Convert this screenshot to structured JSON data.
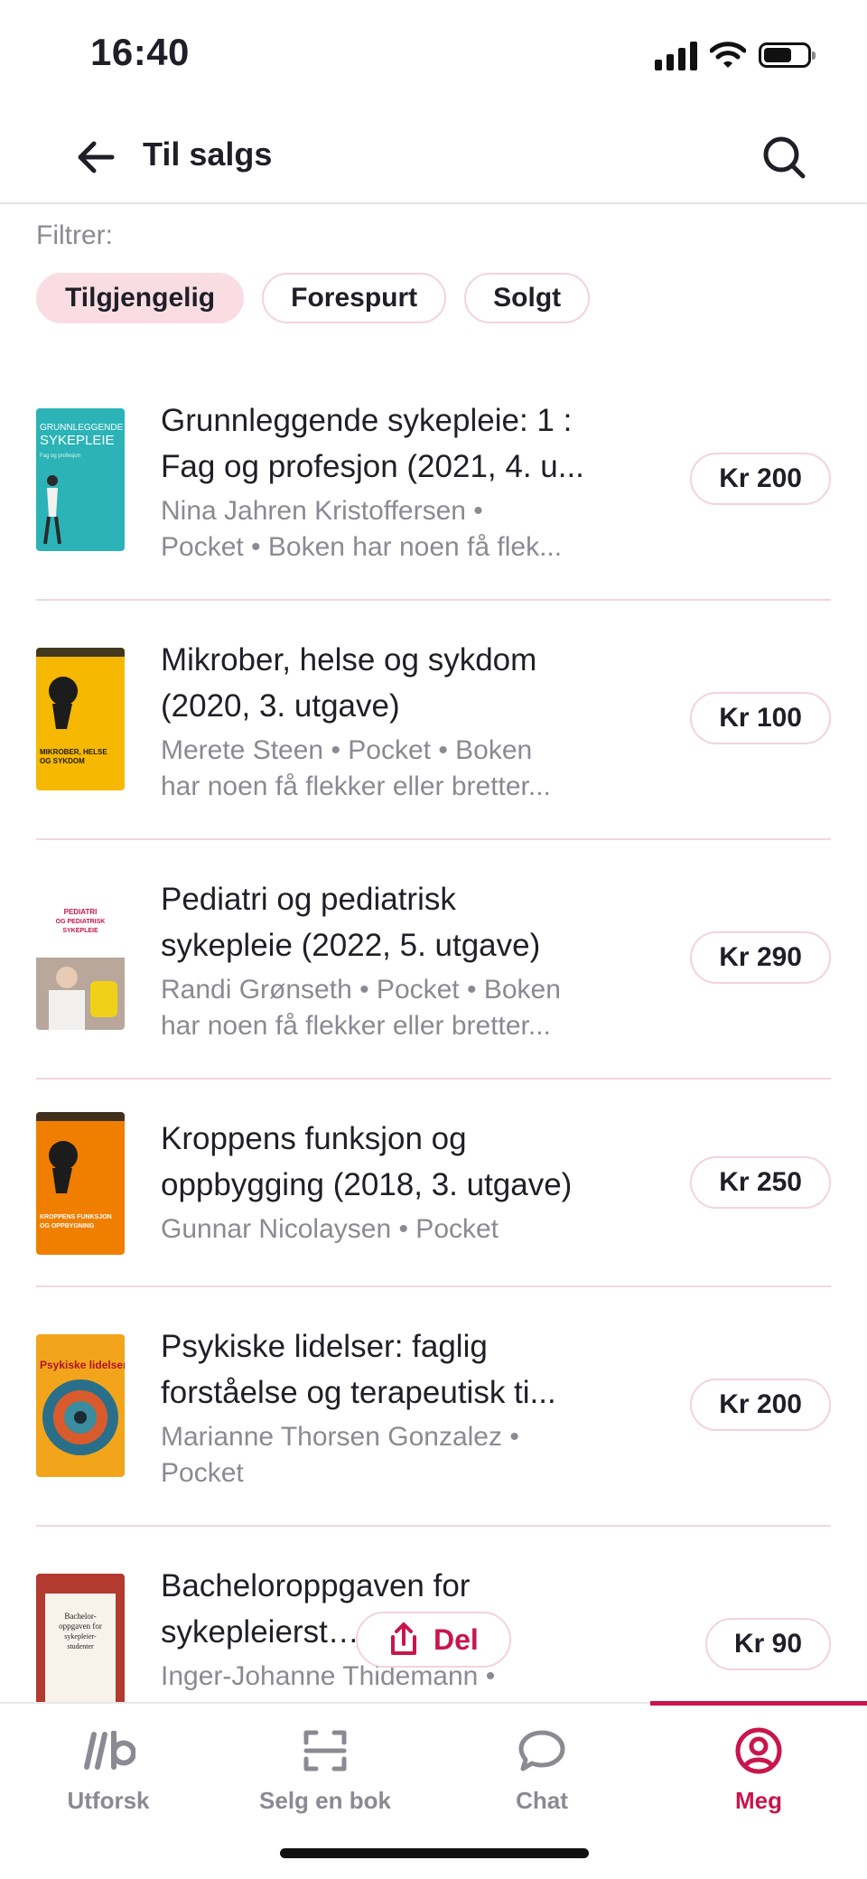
{
  "status": {
    "time": "16:40"
  },
  "header": {
    "title": "Til salgs"
  },
  "filters": {
    "label": "Filtrer:",
    "chips": [
      "Tilgjengelig",
      "Forespurt",
      "Solgt"
    ],
    "active": "Tilgjengelig"
  },
  "listings": [
    {
      "title_line1": "Grunnleggende sykepleie: 1 :",
      "title_line2": "Fag og profesjon (2021, 4. u...",
      "sub_line1": "Nina Jahren Kristoffersen •",
      "sub_line2": "Pocket • Boken har noen få flek...",
      "price": "Kr 200",
      "cover_text": "GRUNNLEGGENDE SYKEPLEIE",
      "cover_color": "#2bb3b7"
    },
    {
      "title_line1": "Mikrober, helse og sykdom",
      "title_line2": "(2020, 3. utgave)",
      "sub_line1": "Merete Steen • Pocket • Boken",
      "sub_line2": "har noen få flekker eller bretter...",
      "price": "Kr 100",
      "cover_text": "MIKROBER, HELSE OG SYKDOM",
      "cover_color": "#f6b800"
    },
    {
      "title_line1": "Pediatri og pediatrisk",
      "title_line2": "sykepleie (2022, 5. utgave)",
      "sub_line1": "Randi Grønseth • Pocket • Boken",
      "sub_line2": "har noen få flekker eller bretter...",
      "price": "Kr 290",
      "cover_text": "PEDIATRI OG PEDIATRISK SYKEPLEIE",
      "cover_color": "#ffffff"
    },
    {
      "title_line1": "Kroppens funksjon og",
      "title_line2": "oppbygging (2018, 3. utgave)",
      "sub_line1": "Gunnar Nicolaysen • Pocket",
      "sub_line2": "",
      "price": "Kr 250",
      "cover_text": "KROPPENS FUNKSJON OG OPPBYGNING",
      "cover_color": "#f07f00"
    },
    {
      "title_line1": "Psykiske lidelser: faglig",
      "title_line2": "forståelse og terapeutisk ti...",
      "sub_line1": "Marianne Thorsen Gonzalez •",
      "sub_line2": "Pocket",
      "price": "Kr 200",
      "cover_text": "Psykiske lidelser",
      "cover_color": "#f2a51a"
    },
    {
      "title_line1": "Bacheloroppgaven for",
      "title_line2": "sykepleierst…den lill...",
      "sub_line1": "Inger-Johanne Thidemann •",
      "sub_line2": "",
      "price": "Kr 90",
      "cover_text": "Bachelor-oppgaven for sykepleier-studenter",
      "cover_color": "#b33a2e"
    }
  ],
  "share": {
    "label": "Del"
  },
  "tabs": [
    {
      "label": "Utforsk",
      "icon": "logo-icon"
    },
    {
      "label": "Selg en bok",
      "icon": "scan-icon"
    },
    {
      "label": "Chat",
      "icon": "chat-bubble-icon"
    },
    {
      "label": "Meg",
      "icon": "profile-icon"
    }
  ],
  "colors": {
    "accent": "#c8164c",
    "chip_active_bg": "#f9dde3",
    "chip_border": "#f3d3da"
  }
}
